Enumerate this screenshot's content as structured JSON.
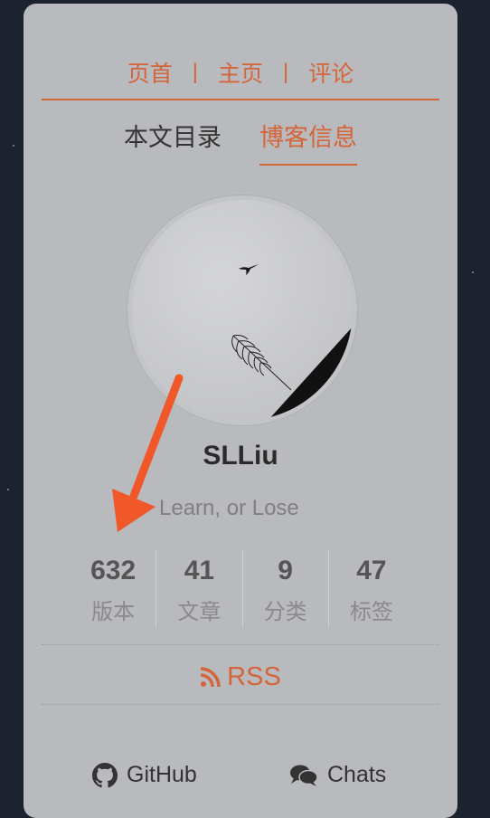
{
  "nav": {
    "links": [
      "页首",
      "主页",
      "评论"
    ],
    "separator": "|"
  },
  "tabs": {
    "toc": "本文目录",
    "blog_info": "博客信息",
    "active": "blog_info"
  },
  "profile": {
    "author": "SLLiu",
    "motto": "Learn, or Lose"
  },
  "stats": [
    {
      "value": "632",
      "label": "版本"
    },
    {
      "value": "41",
      "label": "文章"
    },
    {
      "value": "9",
      "label": "分类"
    },
    {
      "value": "47",
      "label": "标签"
    }
  ],
  "rss": {
    "label": "RSS",
    "icon": "rss-icon"
  },
  "social": {
    "github": {
      "label": "GitHub",
      "icon": "github-icon"
    },
    "chats": {
      "label": "Chats",
      "icon": "chats-icon"
    }
  },
  "colors": {
    "accent": "#d4653a",
    "annotation_arrow": "#f0582a",
    "card_bg": "#b9babd",
    "page_bg": "#1c2230"
  }
}
